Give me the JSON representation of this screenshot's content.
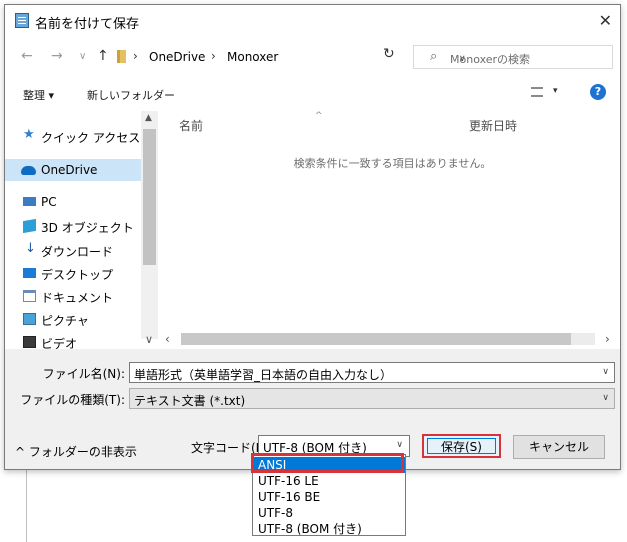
{
  "dialog": {
    "title": "名前を付けて保存",
    "close": "✕"
  },
  "address": {
    "crumbs": [
      "OneDrive",
      "Monoxer"
    ],
    "search_placeholder": "Monoxerの検索"
  },
  "toolbar": {
    "organize": "整理 ▾",
    "new_folder": "新しいフォルダー",
    "help": "?"
  },
  "nav": {
    "items": [
      {
        "label": "クイック アクセス",
        "icon": "star-icon"
      },
      {
        "label": "OneDrive",
        "icon": "cloud-icon"
      },
      {
        "label": "PC",
        "icon": "computer-icon"
      },
      {
        "label": "3D オブジェクト",
        "icon": "cube-icon"
      },
      {
        "label": "ダウンロード",
        "icon": "download-icon"
      },
      {
        "label": "デスクトップ",
        "icon": "desktop-icon"
      },
      {
        "label": "ドキュメント",
        "icon": "document-icon"
      },
      {
        "label": "ピクチャ",
        "icon": "picture-icon"
      },
      {
        "label": "ビデオ",
        "icon": "video-icon"
      }
    ],
    "selected": "OneDrive"
  },
  "list": {
    "col_name": "名前",
    "col_date": "更新日時",
    "empty_message": "検索条件に一致する項目はありません。"
  },
  "form": {
    "filename_label": "ファイル名(N):",
    "filename_value": "単語形式（英単語学習_日本語の自由入力なし）",
    "filetype_label": "ファイルの種類(T):",
    "filetype_value": "テキスト文書 (*.txt)",
    "hide_folders": "^ フォルダーの非表示",
    "encoding_label": "文字コード(E):",
    "encoding_value": "UTF-8 (BOM 付き)",
    "save": "保存(S)",
    "cancel": "キャンセル"
  },
  "encoding_options": [
    "ANSI",
    "UTF-16 LE",
    "UTF-16 BE",
    "UTF-8",
    "UTF-8 (BOM 付き)"
  ],
  "encoding_highlighted": "ANSI",
  "colors": {
    "accent": "#0078d7",
    "highlight_box": "#d6343a",
    "selection": "#cce4f7"
  }
}
